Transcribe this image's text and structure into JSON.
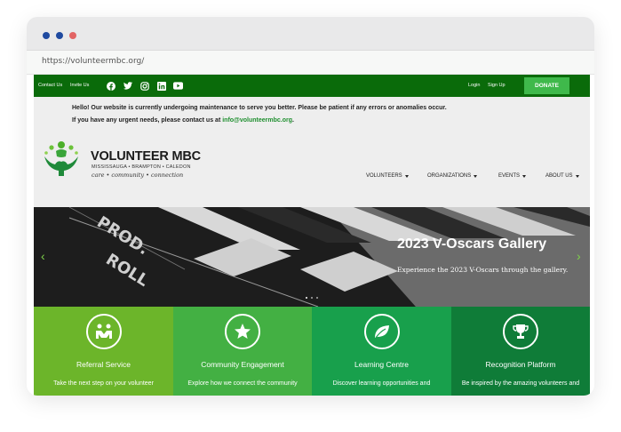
{
  "browser": {
    "url": "https://volunteermbc.org/",
    "dots": [
      "#1f4aa0",
      "#1f4aa0",
      "#e26464"
    ]
  },
  "topbar": {
    "contact_label": "Contact Us",
    "invite_label": "Invite Us",
    "social_icons": [
      "facebook-icon",
      "twitter-icon",
      "instagram-icon",
      "linkedin-icon",
      "youtube-icon"
    ],
    "login_label": "Login",
    "signup_label": "Sign Up",
    "donate_label": "DONATE",
    "bar_color": "#0a6b0a",
    "donate_color": "#3fb94b"
  },
  "notice": {
    "line1": "Hello! Our website is currently undergoing maintenance to serve you better. Please be patient if any errors or anomalies occur.",
    "line2_prefix": "If you have any urgent needs, please contact us at ",
    "email": "info@volunteermbc.org",
    "line2_suffix": "."
  },
  "logo": {
    "name": "VOLUNTEER MBC",
    "cities": "MISSISSAUGA • BRAMPTON • CALEDON",
    "tagline": "care • community • connection"
  },
  "nav": {
    "items": [
      {
        "label": "VOLUNTEERS"
      },
      {
        "label": "ORGANIZATIONS"
      },
      {
        "label": "EVENTS"
      },
      {
        "label": "ABOUT US"
      }
    ]
  },
  "hero": {
    "image_caption_1": "PROD.",
    "image_caption_2": "ROLL",
    "title": "2023 V-Oscars Gallery",
    "subtitle": "Experience the 2023 V-Oscars through the gallery.",
    "prev_arrow": "‹",
    "next_arrow": "›"
  },
  "cards": [
    {
      "title": "Referral Service",
      "subtitle": "Take the next step on your volunteer",
      "icon": "handshake-icon",
      "color": "#6cb52a"
    },
    {
      "title": "Community Engagement",
      "subtitle": "Explore how we connect the community",
      "icon": "star-icon",
      "color": "#43b043"
    },
    {
      "title": "Learning Centre",
      "subtitle": "Discover learning opportunities and",
      "icon": "leaf-icon",
      "color": "#18a04c"
    },
    {
      "title": "Recognition Platform",
      "subtitle": "Be inspired by the amazing volunteers and",
      "icon": "trophy-icon",
      "color": "#0f7c38"
    }
  ]
}
